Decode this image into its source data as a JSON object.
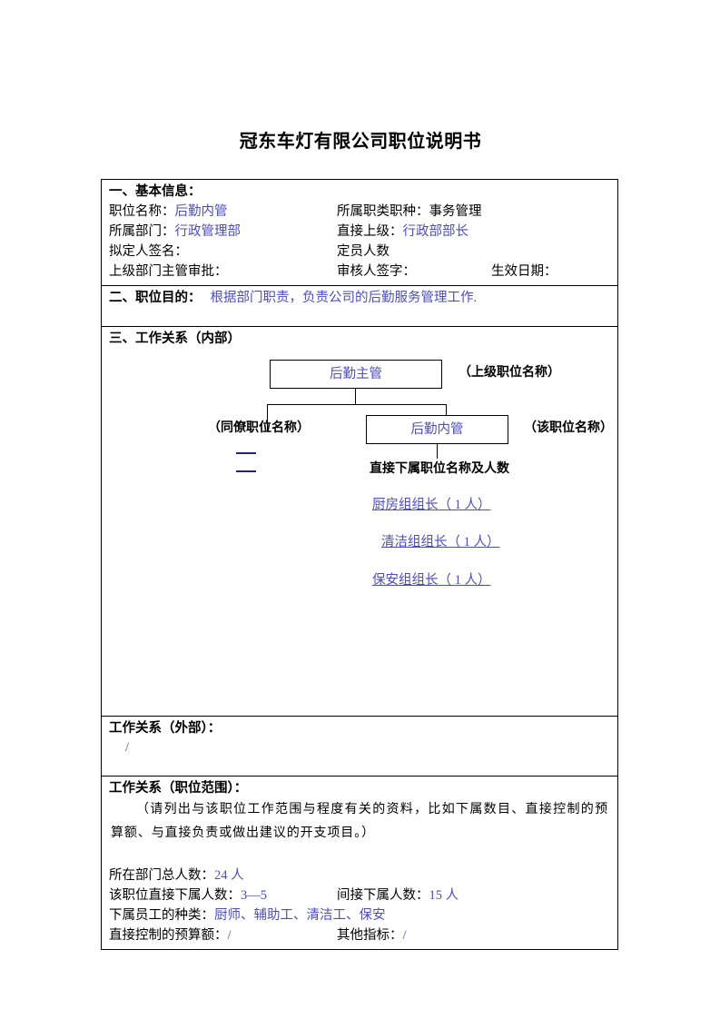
{
  "document": {
    "title": "冠东车灯有限公司职位说明书"
  },
  "section_basic": {
    "heading": "一、基本信息：",
    "rows": [
      {
        "left_label": "职位名称：",
        "left_value": "后勤内管",
        "mid_label": "所属职类职种：",
        "mid_value": "事务管理",
        "right_label": "",
        "right_value": ""
      },
      {
        "left_label": "所属部门：",
        "left_value": "行政管理部",
        "mid_label": "直接上级：",
        "mid_value": "行政部部长",
        "right_label": "",
        "right_value": ""
      },
      {
        "left_label": "拟定人签名：",
        "left_value": "",
        "mid_label": "定员人数",
        "mid_value": "",
        "right_label": "",
        "right_value": ""
      },
      {
        "left_label": "上级部门主管审批：",
        "left_value": "",
        "mid_label": "审核人签字：",
        "mid_value": "",
        "right_label": "生效日期：",
        "right_value": ""
      }
    ]
  },
  "section_purpose": {
    "heading": "二、职位目的：",
    "value": "根据部门职责，负责公司的后勤服务管理工作."
  },
  "section_relations_internal": {
    "heading": "三、工作关系（内部）",
    "chart": {
      "superior_box": "后勤主管",
      "superior_label": "（上级职位名称）",
      "peer_label": "（同僚职位名称）",
      "self_box": "后勤内管",
      "self_label": "（该职位名称）",
      "subordinates_heading": "直接下属职位名称及人数",
      "subordinates": [
        "厨房组组长（ 1 人）",
        "清洁组组长（ 1 人）",
        "保安组组长（ 1 人）"
      ],
      "peer_placeholders": [
        "",
        ""
      ]
    }
  },
  "section_relations_external": {
    "heading": "工作关系（外部）：",
    "value": "/"
  },
  "section_scope": {
    "heading": "工作关系（职位范围）：",
    "note": "（请列出与该职位工作范围与程度有关的资料，比如下属数目、直接控制的预算额、与直接负责或做出建议的开支项目。）",
    "rows": [
      {
        "left_label": "所在部门总人数：",
        "left_value": "24 人",
        "right_label": "",
        "right_value": ""
      },
      {
        "left_label": "该职位直接下属人数：",
        "left_value": "3—5",
        "right_label": "间接下属人数：",
        "right_value": "15 人"
      },
      {
        "left_label": "下属员工的种类：",
        "left_value": "厨师、辅助工、清洁工、保安",
        "right_label": "",
        "right_value": ""
      },
      {
        "left_label": "直接控制的预算额：",
        "left_value": "/",
        "right_label": "其他指标：",
        "right_value": "/"
      }
    ]
  },
  "colors": {
    "accent_blue": "#4d4dbf",
    "dash_blue": "#22227a",
    "text": "#000000",
    "border": "#000000"
  }
}
